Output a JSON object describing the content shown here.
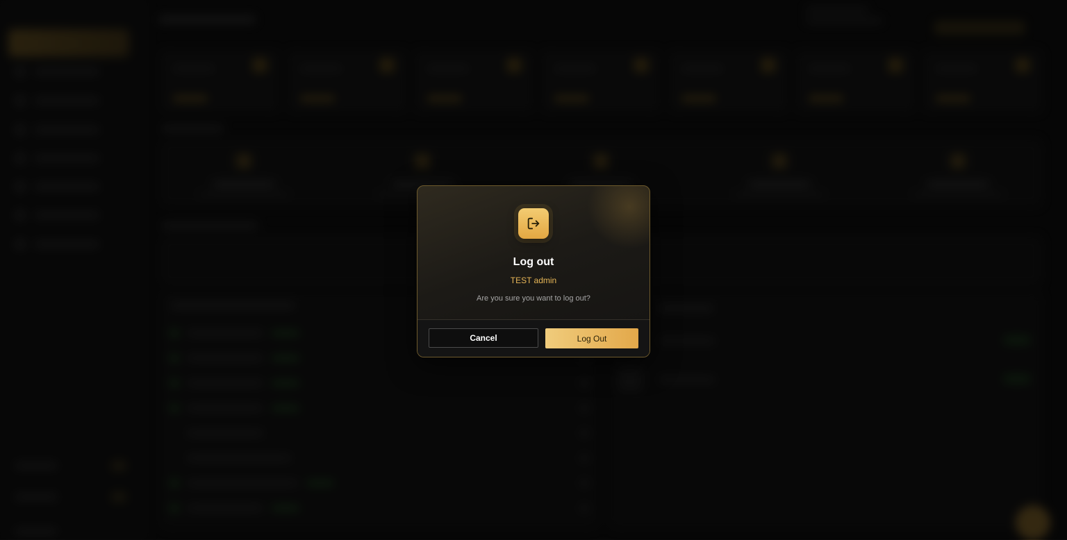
{
  "modal": {
    "title": "Log out",
    "user_name": "TEST admin",
    "message": "Are you sure you want to log out?",
    "cancel_label": "Cancel",
    "confirm_label": "Log Out",
    "icon": "logout-icon"
  },
  "colors": {
    "accent": "#e7b657",
    "accent_gradient_start": "#f0cc7c",
    "accent_gradient_end": "#e3a84a",
    "modal_border": "#6e5a2c",
    "background": "#0a0a0a",
    "success": "#1f4a1f"
  }
}
